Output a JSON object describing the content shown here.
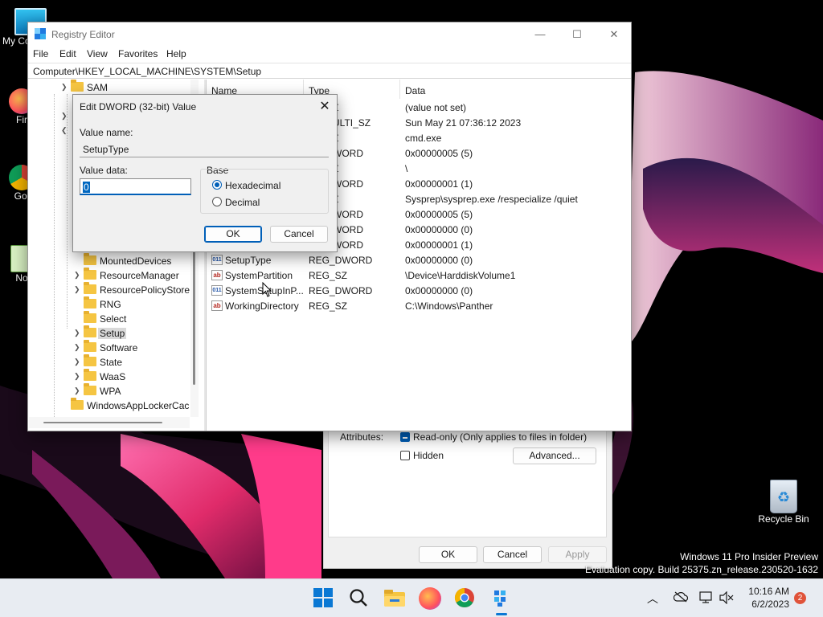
{
  "desktop": {
    "icons": [
      {
        "label": "My Co"
      },
      {
        "label": "Fir"
      },
      {
        "label": "Go Chr"
      },
      {
        "label": "Note"
      },
      {
        "label": "Recycle Bin"
      }
    ],
    "watermark_line1": "Windows 11 Pro Insider Preview",
    "watermark_line2": "Evaluation copy. Build 25375.zn_release.230520-1632"
  },
  "properties": {
    "attributes_label": "Attributes:",
    "readonly_label": "Read-only (Only applies to files in folder)",
    "hidden_label": "Hidden",
    "advanced_label": "Advanced...",
    "ok_label": "OK",
    "cancel_label": "Cancel",
    "apply_label": "Apply"
  },
  "regedit": {
    "title": "Registry Editor",
    "caption": {
      "minimize": "—",
      "maximize": "☐",
      "close": "✕"
    },
    "menu": [
      "File",
      "Edit",
      "View",
      "Favorites",
      "Help"
    ],
    "address": "Computer\\HKEY_LOCAL_MACHINE\\SYSTEM\\Setup",
    "tree": [
      {
        "label": "SAM"
      },
      {
        "label": "MountedDevices"
      },
      {
        "label": "ResourceManager"
      },
      {
        "label": "ResourcePolicyStore"
      },
      {
        "label": "RNG"
      },
      {
        "label": "Select"
      },
      {
        "label": "Setup"
      },
      {
        "label": "Software"
      },
      {
        "label": "State"
      },
      {
        "label": "WaaS"
      },
      {
        "label": "WPA"
      },
      {
        "label": "WindowsAppLockerCac"
      }
    ],
    "columns": {
      "name": "Name",
      "type": "Type",
      "data": "Data"
    },
    "rows": [
      {
        "name": "",
        "type": "Z",
        "data": "(value not set)"
      },
      {
        "name": "",
        "type": "ULTI_SZ",
        "data": "Sun May 21 07:36:12 2023"
      },
      {
        "name": "",
        "type": "Z",
        "data": "cmd.exe"
      },
      {
        "name": "",
        "type": "WORD",
        "data": "0x00000005 (5)"
      },
      {
        "name": "",
        "type": "Z",
        "data": "\\"
      },
      {
        "name": "",
        "type": "WORD",
        "data": "0x00000001 (1)"
      },
      {
        "name": "",
        "type": "Z",
        "data": "Sysprep\\sysprep.exe /respecialize /quiet"
      },
      {
        "name": "",
        "type": "WORD",
        "data": "0x00000005 (5)"
      },
      {
        "name": "",
        "type": "WORD",
        "data": "0x00000000 (0)"
      },
      {
        "name": "",
        "type": "WORD",
        "data": "0x00000001 (1)"
      },
      {
        "name": "SetupType",
        "type": "REG_DWORD",
        "data": "0x00000000 (0)"
      },
      {
        "name": "SystemPartition",
        "type": "REG_SZ",
        "data": "\\Device\\HarddiskVolume1"
      },
      {
        "name": "SystemSetupInP...",
        "type": "REG_DWORD",
        "data": "0x00000000 (0)"
      },
      {
        "name": "WorkingDirectory",
        "type": "REG_SZ",
        "data": "C:\\Windows\\Panther"
      }
    ]
  },
  "dword_dialog": {
    "title": "Edit DWORD (32-bit) Value",
    "close": "✕",
    "value_name_label": "Value name:",
    "value_name": "SetupType",
    "value_data_label": "Value data:",
    "value_data": "0",
    "base_label": "Base",
    "hex_label": "Hexadecimal",
    "dec_label": "Decimal",
    "ok_label": "OK",
    "cancel_label": "Cancel"
  },
  "taskbar": {
    "time": "10:16 AM",
    "date": "6/2/2023",
    "notification_count": "2"
  }
}
